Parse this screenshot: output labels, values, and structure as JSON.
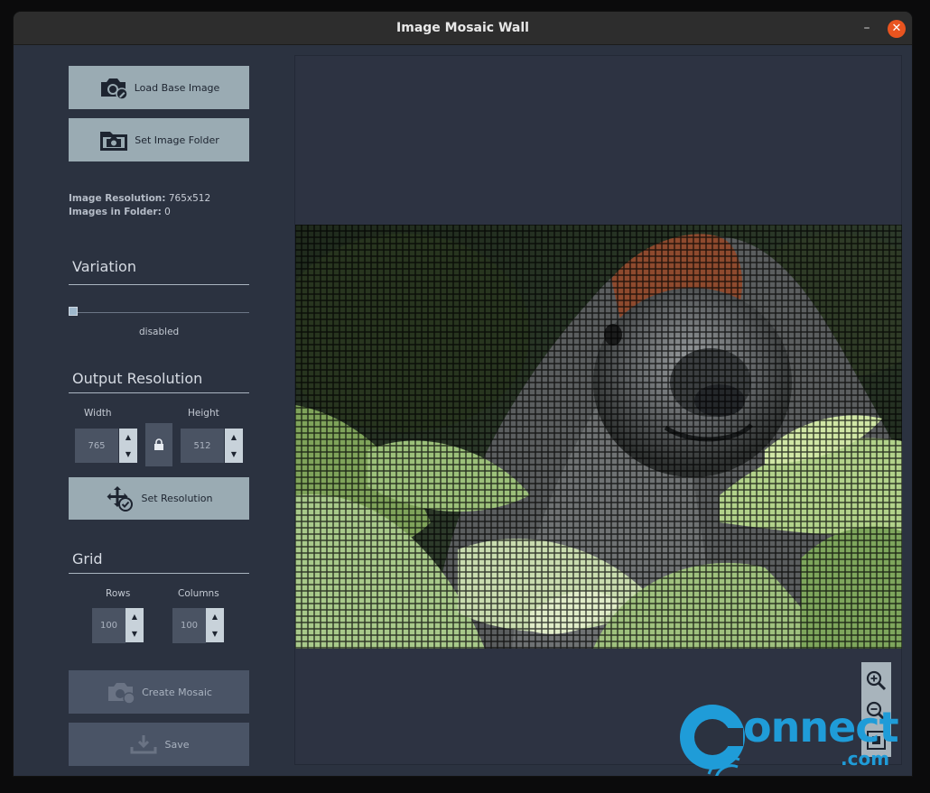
{
  "window": {
    "title": "Image Mosaic Wall",
    "minimize_icon": "minimize-icon",
    "close_icon": "close-icon"
  },
  "buttons": {
    "load_base_image": "Load Base Image",
    "set_image_folder": "Set Image Folder",
    "set_resolution": "Set Resolution",
    "create_mosaic": "Create Mosaic",
    "save": "Save"
  },
  "info": {
    "resolution_label": "Image Resolution:",
    "resolution_value": "765x512",
    "folder_label": "Images in Folder:",
    "folder_value": "0"
  },
  "variation": {
    "title": "Variation",
    "state": "disabled",
    "slider_value": 0
  },
  "output_resolution": {
    "title": "Output Resolution",
    "width_label": "Width",
    "height_label": "Height",
    "width_value": "765",
    "height_value": "512"
  },
  "grid": {
    "title": "Grid",
    "rows_label": "Rows",
    "columns_label": "Columns",
    "rows_value": "100",
    "columns_value": "100"
  },
  "zoom": {
    "zoom_in_icon": "zoom-in-icon",
    "zoom_out_icon": "zoom-out-icon"
  },
  "watermark": {
    "text_main": "onnect",
    "text_sub": ".com"
  },
  "colors": {
    "accent_close": "#e9541f",
    "button": "#9aabb3",
    "panel": "#2b3240"
  }
}
